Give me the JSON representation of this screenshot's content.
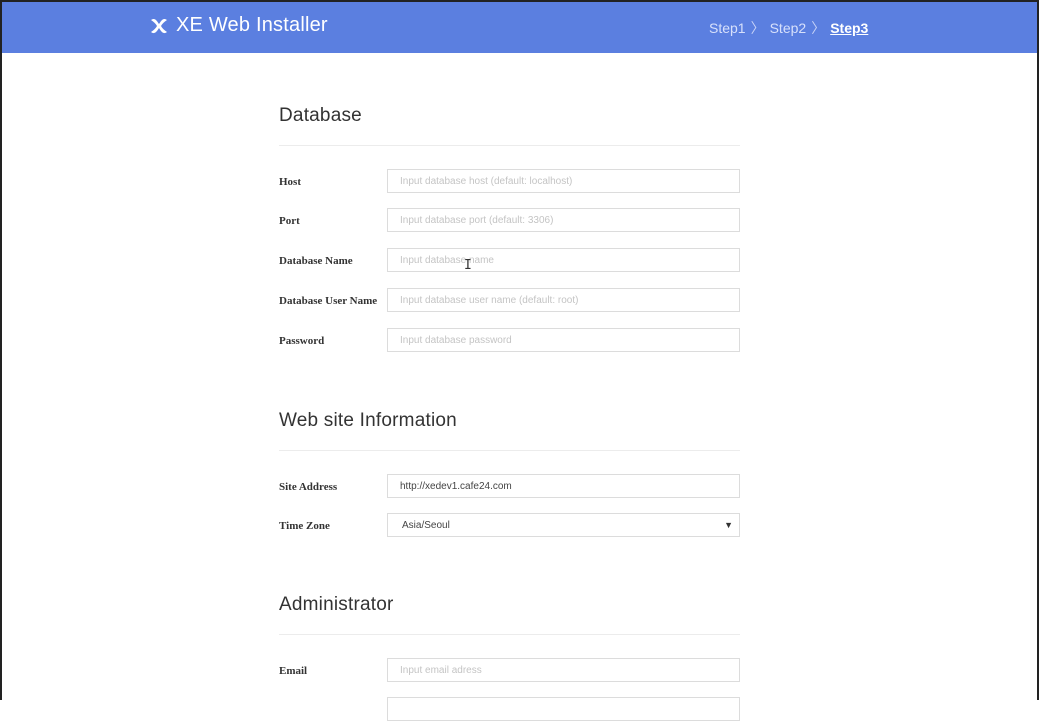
{
  "header": {
    "app_title": "XE Web Installer",
    "logo_icon": "xe-logo-icon",
    "steps": [
      {
        "label": "Step1",
        "active": false
      },
      {
        "label": "Step2",
        "active": false
      },
      {
        "label": "Step3",
        "active": true
      }
    ],
    "separator": "〉"
  },
  "database": {
    "title": "Database",
    "host": {
      "label": "Host",
      "placeholder": "Input database host (default: localhost)"
    },
    "port": {
      "label": "Port",
      "placeholder": "Input database port (default: 3306)"
    },
    "name": {
      "label": "Database Name",
      "placeholder": "Input database name"
    },
    "user": {
      "label": "Database User Name",
      "placeholder": "Input database user name (default: root)"
    },
    "password": {
      "label": "Password",
      "placeholder": "Input database password"
    }
  },
  "website": {
    "title": "Web site Information",
    "site_address": {
      "label": "Site Address",
      "value": "http://xedev1.cafe24.com"
    },
    "time_zone": {
      "label": "Time Zone",
      "value": "Asia/Seoul"
    }
  },
  "administrator": {
    "title": "Administrator",
    "email": {
      "label": "Email",
      "placeholder": "Input email adress"
    }
  },
  "colors": {
    "header_bg": "#5b7fe0"
  }
}
